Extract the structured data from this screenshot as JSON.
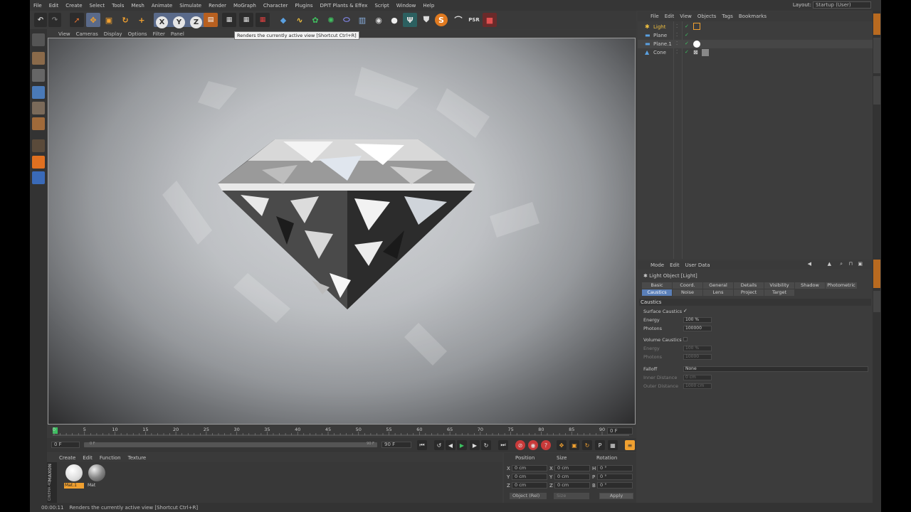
{
  "menubar": {
    "items": [
      "File",
      "Edit",
      "Create",
      "Select",
      "Tools",
      "Mesh",
      "Animate",
      "Simulate",
      "Render",
      "MoGraph",
      "Character",
      "Plugins",
      "DPIT Plants & Effex",
      "Script",
      "Window",
      "Help"
    ],
    "layout_label": "Layout:",
    "layout_value": "Startup (User)"
  },
  "toolbar": {
    "axis_x": "X",
    "axis_y": "Y",
    "axis_z": "Z",
    "tooltip": "Renders the currently active view [Shortcut Ctrl+R]"
  },
  "viewport": {
    "menu": [
      "View",
      "Cameras",
      "Display",
      "Options",
      "Filter",
      "Panel"
    ]
  },
  "timeline": {
    "ticks": [
      "0",
      "5",
      "10",
      "15",
      "20",
      "25",
      "30",
      "35",
      "40",
      "45",
      "50",
      "55",
      "60",
      "65",
      "70",
      "75",
      "80",
      "85",
      "90"
    ],
    "end_frame": "0 F",
    "start_field": "0 F",
    "range_min": "0 F",
    "range_max": "90 F",
    "end_field": "90 F"
  },
  "materials": {
    "menu": [
      "Create",
      "Edit",
      "Function",
      "Texture"
    ],
    "items": [
      {
        "name": "Mat.1",
        "selected": true
      },
      {
        "name": "Mat",
        "selected": false
      }
    ],
    "brand_line1": "MAXON",
    "brand_line2": "CINEMA 4D"
  },
  "coordinates": {
    "headers": [
      "Position",
      "Size",
      "Rotation"
    ],
    "rows": [
      {
        "axis": "X",
        "pos": "0 cm",
        "size_axis": "X",
        "size": "0 cm",
        "rot_axis": "H",
        "rot": "0 °"
      },
      {
        "axis": "Y",
        "pos": "0 cm",
        "size_axis": "Y",
        "size": "0 cm",
        "rot_axis": "P",
        "rot": "0 °"
      },
      {
        "axis": "Z",
        "pos": "0 cm",
        "size_axis": "Z",
        "size": "0 cm",
        "rot_axis": "B",
        "rot": "0 °"
      }
    ],
    "mode": "Object (Rel)",
    "size_mode": "Size",
    "apply": "Apply"
  },
  "status": {
    "time": "00:00:11",
    "text": "Renders the currently active view [Shortcut Ctrl+R]"
  },
  "objects": {
    "menu": [
      "File",
      "Edit",
      "View",
      "Objects",
      "Tags",
      "Bookmarks"
    ],
    "items": [
      {
        "name": "Light",
        "color": "#f0c040"
      },
      {
        "name": "Plane",
        "color": "#c8c8c8"
      },
      {
        "name": "Plane.1",
        "color": "#c8c8c8"
      },
      {
        "name": "Cone",
        "color": "#c8c8c8"
      }
    ]
  },
  "attributes": {
    "menu": [
      "Mode",
      "Edit",
      "User Data"
    ],
    "title": "Light Object [Light]",
    "tabs_row1": [
      "Basic",
      "Coord.",
      "General",
      "Details",
      "Visibility",
      "Shadow",
      "Photometric"
    ],
    "tabs_row2": [
      "Caustics",
      "Noise",
      "Lens",
      "Project",
      "Target"
    ],
    "active_tab": "Caustics",
    "section": "Caustics",
    "surface_caustics": "Surface Caustics",
    "energy_label": "Energy",
    "energy_value": "100 %",
    "photons_label": "Photons",
    "photons_value": "100000",
    "volume_caustics": "Volume Caustics",
    "v_energy_label": "Energy",
    "v_energy_value": "100 %",
    "v_photons_label": "Photons",
    "v_photons_value": "10000",
    "falloff_label": "Falloff",
    "falloff_value": "None",
    "inner_label": "Inner Distance",
    "inner_value": "0 cm",
    "outer_label": "Outer Distance",
    "outer_value": "1000 cm"
  },
  "colors": {
    "accent_blue": "#5a7fb8",
    "orange": "#f0a030",
    "play_green": "#3cc060",
    "record_red": "#d04040"
  }
}
